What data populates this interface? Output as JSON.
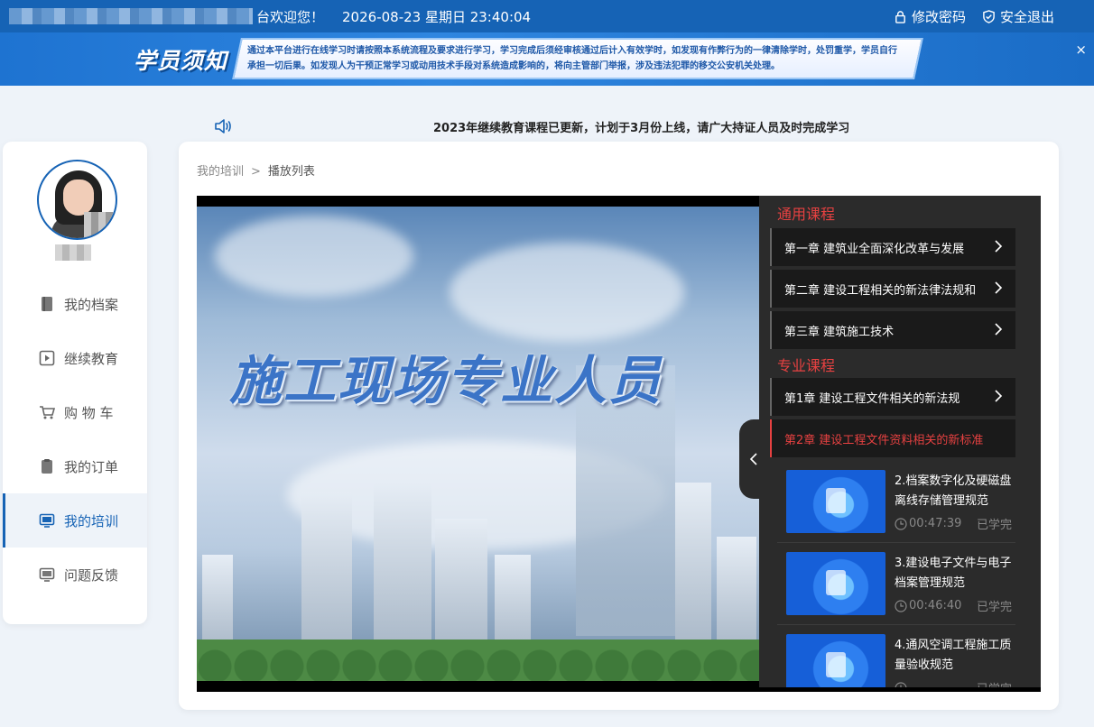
{
  "topbar": {
    "welcome": "台欢迎您！",
    "datetime": "2026-08-23 星期日 23:40:04",
    "change_password": "修改密码",
    "logout": "安全退出"
  },
  "notice": {
    "badge": "学员须知",
    "text": "通过本平台进行在线学习时请按照本系统流程及要求进行学习，学习完成后须经审核通过后计入有效学时，如发现有作弊行为的一律清除学时，处罚重学，学员自行承担一切后果。如发现人为干预正常学习或动用技术手段对系统造成影响的，将向主管部门举报，涉及违法犯罪的移交公安机关处理。",
    "close": "×"
  },
  "marquee": "2023年继续教育课程已更新，计划于3月份上线，请广大持证人员及时完成学习",
  "sidebar": {
    "items": [
      {
        "label": "我的档案",
        "icon": "book-icon"
      },
      {
        "label": "继续教育",
        "icon": "play-icon"
      },
      {
        "label": "购 物 车",
        "icon": "cart-icon"
      },
      {
        "label": "我的订单",
        "icon": "order-icon"
      },
      {
        "label": "我的培训",
        "icon": "monitor-icon",
        "active": true
      },
      {
        "label": "问题反馈",
        "icon": "monitor-icon"
      }
    ]
  },
  "breadcrumb": {
    "root": "我的培训",
    "sep": ">",
    "current": "播放列表"
  },
  "video": {
    "headline": "施工现场专业人员"
  },
  "playlist": {
    "general_title": "通用课程",
    "general": [
      "第一章 建筑业全面深化改革与发展",
      "第二章 建设工程相关的新法律法规和",
      "第三章 建筑施工技术"
    ],
    "pro_title": "专业课程",
    "pro": [
      "第1章 建设工程文件相关的新法规",
      "第2章 建设工程文件资料相关的新标准"
    ],
    "lessons": [
      {
        "title": "2.档案数字化及硬磁盘离线存储管理规范",
        "duration": "00:47:39",
        "status": "已学完"
      },
      {
        "title": "3.建设电子文件与电子档案管理规范",
        "duration": "00:46:40",
        "status": "已学完"
      },
      {
        "title": "4.通风空调工程施工质量验收规范",
        "duration": "",
        "status": "已学完"
      }
    ]
  },
  "colors": {
    "primary": "#1663b5",
    "accent_red": "#e64141",
    "panel_bg": "#2b2b2b"
  }
}
